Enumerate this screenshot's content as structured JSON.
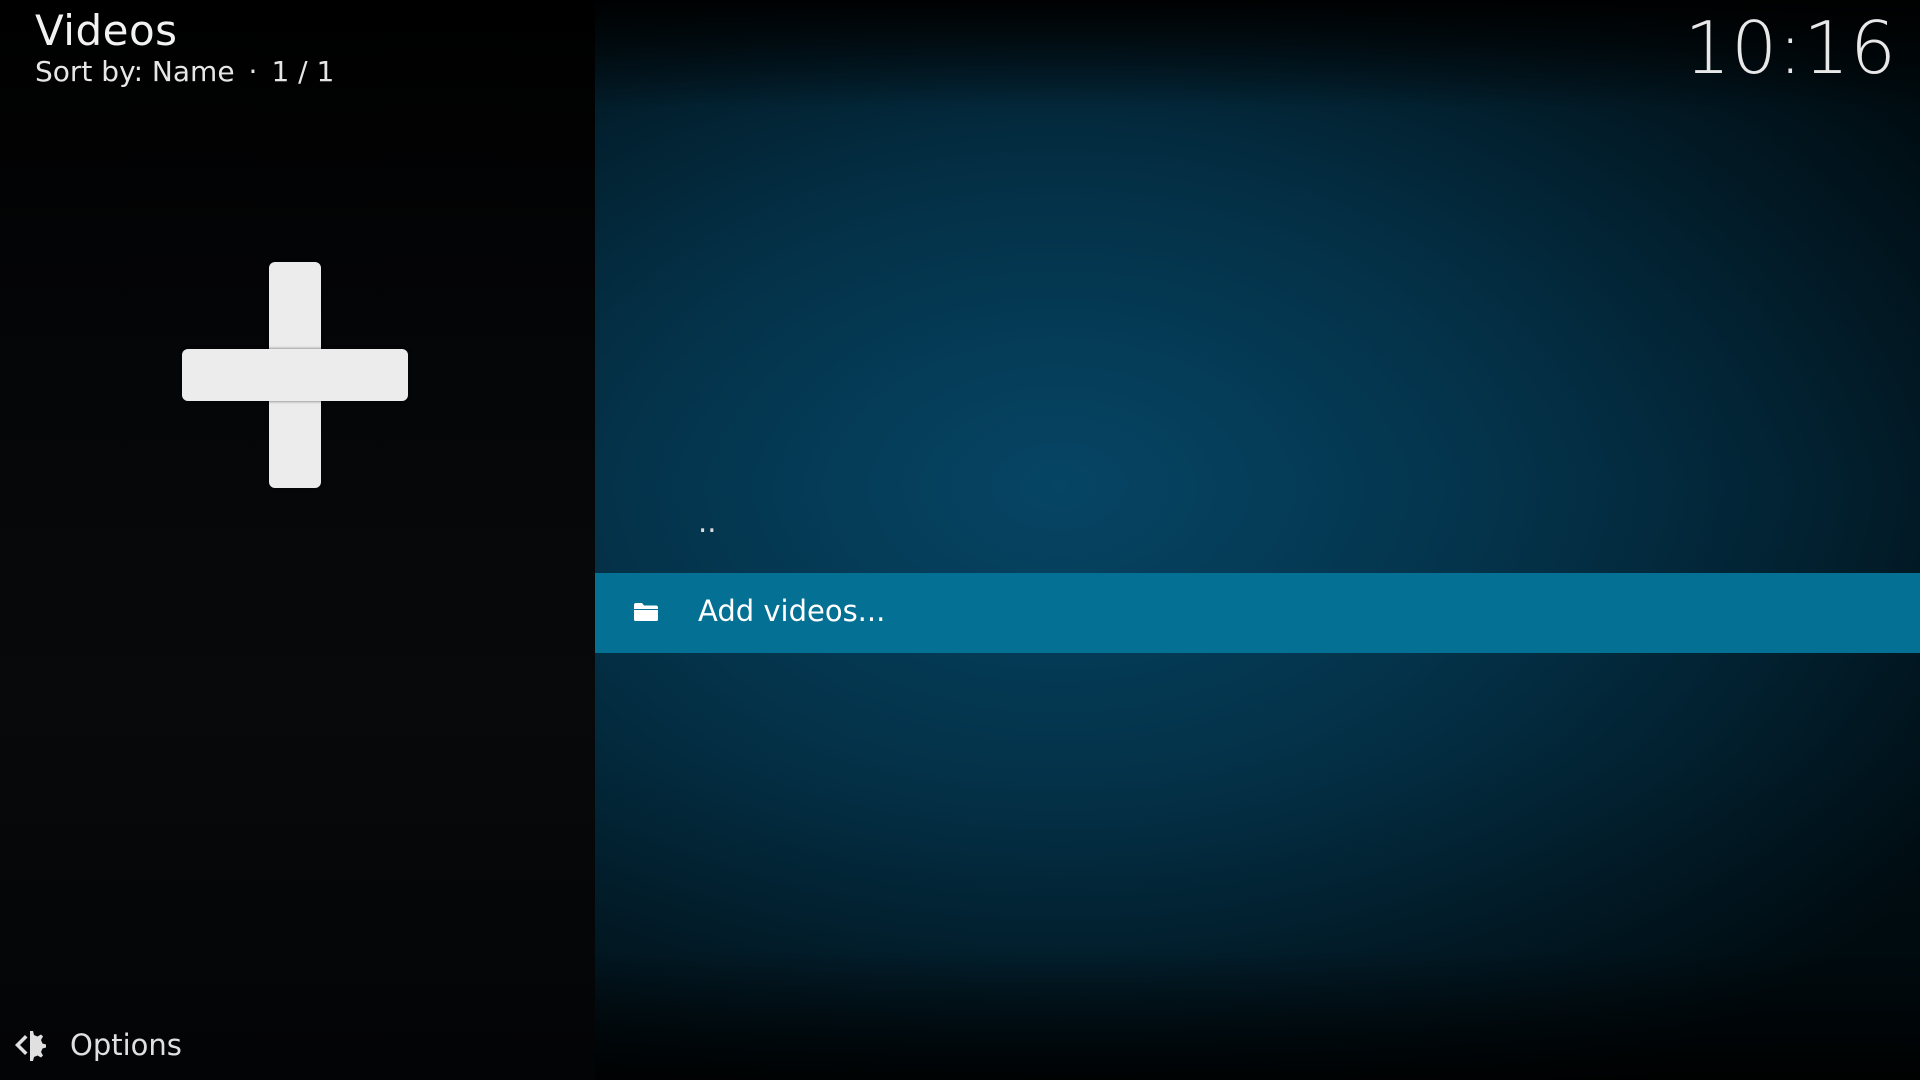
{
  "header": {
    "title": "Videos",
    "sort_label": "Sort by: Name",
    "separator": "·",
    "page_count": "1 / 1"
  },
  "clock": {
    "time": "10:16"
  },
  "thumbnail": {
    "icon": "plus-icon"
  },
  "list": {
    "items": [
      {
        "label": "..",
        "icon": "",
        "selected": false
      },
      {
        "label": "Add videos...",
        "icon": "folder-icon",
        "selected": true
      }
    ]
  },
  "footer": {
    "options_label": "Options",
    "options_icon": "gear-icon"
  },
  "colors": {
    "selection": "#037094",
    "background_accent": "#03324a"
  }
}
